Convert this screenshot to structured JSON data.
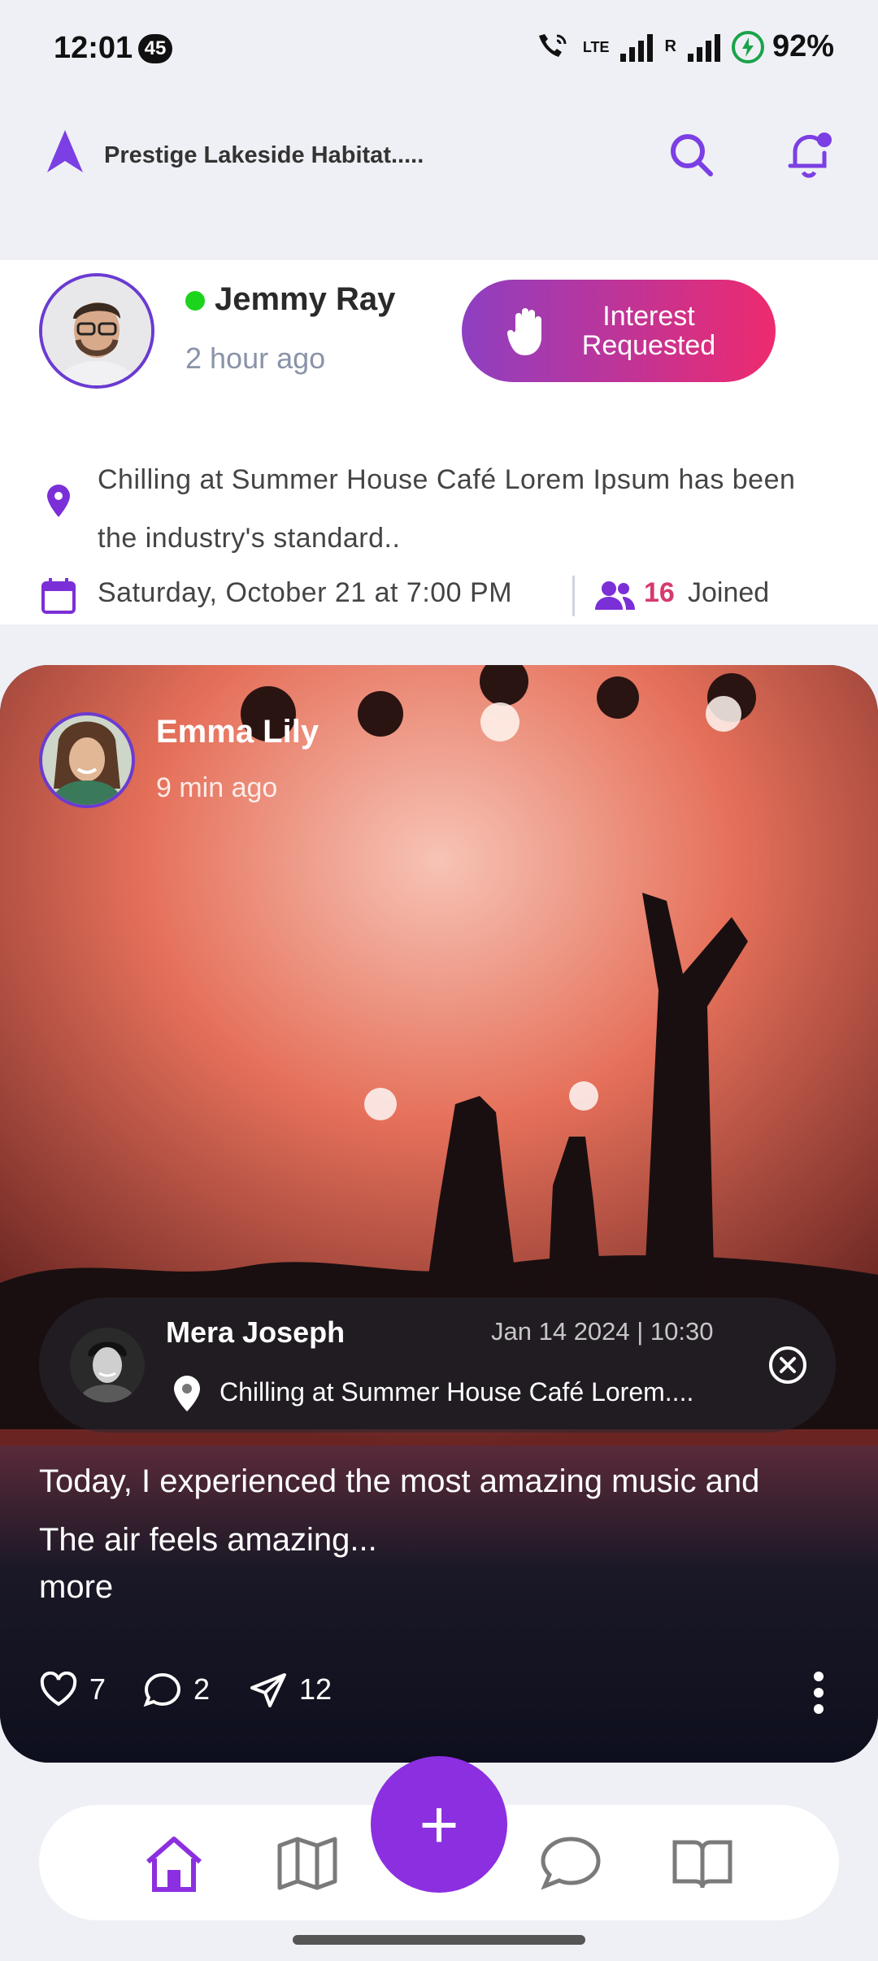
{
  "status_bar": {
    "time": "12:01",
    "notification_count": "45",
    "battery": "92%",
    "network": "LTE"
  },
  "header": {
    "title": "Prestige Lakeside Habitat.....",
    "accent": "#7b3fe4"
  },
  "post1": {
    "user_name": "Jemmy Ray",
    "time_ago": "2 hour ago",
    "interest_button": "Interest Requested",
    "location_text": "Chilling at Summer House Café Lorem Ipsum has been the industry's standard..",
    "date": "Saturday, October 21 at 7:00 PM",
    "joined_count": "16",
    "joined_label": "Joined"
  },
  "post2": {
    "user_name": "Emma Lily",
    "time_ago": "9 min ago",
    "mention": {
      "name": "Mera Joseph",
      "date": "Jan 14 2024 | 10:30",
      "location": "Chilling at Summer House Café Lorem...."
    },
    "text": "Today, I experienced the most amazing music and The air feels amazing...",
    "more": "more",
    "likes": "7",
    "comments": "2",
    "shares": "12"
  },
  "bottom_nav": {
    "items": [
      "home-icon",
      "map-icon",
      "add-icon",
      "chat-icon",
      "book-icon"
    ],
    "fab_label": "+",
    "active_color": "#8c2fe0"
  }
}
